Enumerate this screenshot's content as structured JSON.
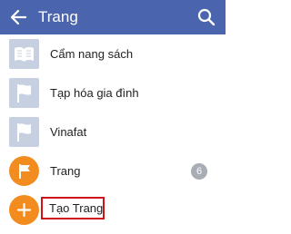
{
  "appbar": {
    "back_icon": "arrow-left-icon",
    "title": "Trang",
    "search_icon": "search-icon"
  },
  "items": [
    {
      "label": "Cẩm nang sách",
      "icon": "open-book-icon"
    },
    {
      "label": "Tạp hóa gia đình",
      "icon": "flag-icon"
    },
    {
      "label": "Vinafat",
      "icon": "flag-icon"
    },
    {
      "label": "Trang",
      "icon": "flag-icon",
      "badge": "6"
    },
    {
      "label": "Tạo Trang",
      "icon": "plus-icon"
    }
  ],
  "colors": {
    "appbar": "#4a65ad",
    "accent_orange": "#f28c1e",
    "placeholder_thumb": "#c7d0e1",
    "badge": "#a9adb5",
    "highlight_border": "#d0121b"
  }
}
